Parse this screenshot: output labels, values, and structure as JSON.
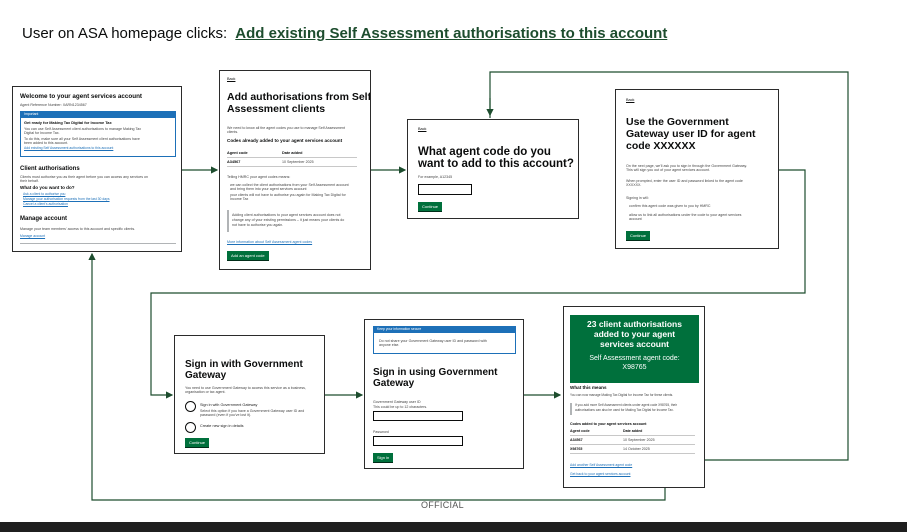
{
  "header": {
    "prefix": "User on ASA homepage clicks:",
    "link_text": "Add existing Self Assessment authorisations to this account"
  },
  "footer": {
    "classification": "OFFICIAL"
  },
  "colors": {
    "govuk_green": "#00703c",
    "success_green": "#00703c",
    "link_blue": "#1d70b8",
    "arrow": "#1d4d2e"
  },
  "screens": {
    "homepage": {
      "title": "Welcome to your agent services account",
      "arn": "Agent Reference Number: XARN1234567",
      "banner_title": "Important",
      "banner_heading": "Get ready for Making Tax Digital for Income Tax",
      "banner_body_1": "You can use Self Assessment client authorisations to manage Making Tax",
      "banner_body_2": "Digital for Income Tax.",
      "banner_body_3": "To do this, make sure all your Self Assessment client authorisations have",
      "banner_body_4": "been added to this account.",
      "banner_link": "Add existing Self Assessment authorisations to this account",
      "clients_heading": "Client authorisations",
      "clients_body_1": "Clients must authorise you as their agent before you can access any services on",
      "clients_body_2": "their behalf.",
      "todo_heading": "What do you want to do?",
      "todo_links": [
        "Ask a client to authorise you",
        "Manage your authorisation requests from the last 30 days",
        "Cancel a client's authorisation"
      ],
      "manage_heading": "Manage account",
      "manage_body": "Manage your team members' access to this account and specific clients.",
      "manage_link": "Manage account"
    },
    "add_auths": {
      "back": "Back",
      "title_1": "Add authorisations from Self",
      "title_2": "Assessment clients",
      "intro_1": "We need to know all the agent codes you use to manage Self Assessment",
      "intro_2": "clients.",
      "codes_heading": "Codes already added to your agent services account",
      "col_code": "Agent code",
      "col_date": "Date added",
      "rows": [
        {
          "code": "A34567",
          "date": "10 September 2025"
        }
      ],
      "hmrc_means": "Telling HMRC your agent codes means:",
      "bullet_1a": "we can collect the client authorisations from your Self Assessment account",
      "bullet_1b": "and bring them into your agent services account",
      "bullet_2a": "your clients will not have to authorise you again for Making Tax Digital for",
      "bullet_2b": "Income Tax",
      "inset_1": "Adding client authorisations to your agent services account does not",
      "inset_2": "change any of your existing permissions – it just means your clients do",
      "inset_3": "not have to authorise you again.",
      "more_info": "More information about Self Assessment agent codes",
      "button": "Add an agent code"
    },
    "agent_code": {
      "back": "Back",
      "title_1": "What agent code do you",
      "title_2": "want to add to this account?",
      "hint": "For example, A12345",
      "button": "Continue"
    },
    "gg_user_id": {
      "back": "Back",
      "title_1": "Use the Government",
      "title_2": "Gateway user ID for agent",
      "title_3": "code XXXXXX",
      "p1a": "On the next page, we'll ask you to sign in through the Government Gateway.",
      "p1b": "This will sign you out of your agent services account.",
      "p2a": "When prompted, enter the user ID and password linked to the agent code",
      "p2b": "XXXXXX.",
      "p3": "Signing in will:",
      "b1": "confirm this agent code was given to you by HMRC",
      "b2a": "allow us to link all authorisations under the code to your agent services",
      "b2b": "account",
      "button": "Continue"
    },
    "sign_in_gg": {
      "title_1": "Sign in with Government",
      "title_2": "Gateway",
      "p1a": "You need to use Government Gateway to access this service as a business,",
      "p1b": "organisation or tax agent.",
      "r1_label": "Sign in with Government Gateway",
      "r1_hint_a": "Select this option if you have a Government Gateway user ID and",
      "r1_hint_b": "password (even if you've lost it).",
      "r2_label": "Create new sign in details",
      "button": "Continue"
    },
    "sign_in_using": {
      "banner_title": "Keep your information secure",
      "banner_body_a": "Do not share your Government Gateway user ID and password with",
      "banner_body_b": "anyone else.",
      "title_1": "Sign in using Government",
      "title_2": "Gateway",
      "uid_label": "Government Gateway user ID",
      "uid_hint": "This could be up to 12 characters.",
      "pwd_label": "Password",
      "button": "Sign in"
    },
    "confirmation": {
      "panel_1": "23 client authorisations",
      "panel_2": "added to your agent",
      "panel_3": "services account",
      "panel_sub_1": "Self Assessment agent code:",
      "panel_sub_2": "X98765",
      "means_heading": "What this means",
      "means_body": "You can now manage Making Tax Digital for Income Tax for these clients.",
      "inset_a": "If you add more Self Assessment clients under agent code X98765, their",
      "inset_b": "authorisations can also be used for Making Tax Digital for Income Tax.",
      "codes_heading": "Codes added to your agent services account",
      "col_code": "Agent code",
      "col_date": "Date added",
      "rows": [
        {
          "code": "A34567",
          "date": "10 September 2025"
        },
        {
          "code": "X98765",
          "date": "14 October 2025"
        }
      ],
      "link_1": "Add another Self Assessment agent code",
      "link_2": "Get back to your agent services account"
    }
  }
}
